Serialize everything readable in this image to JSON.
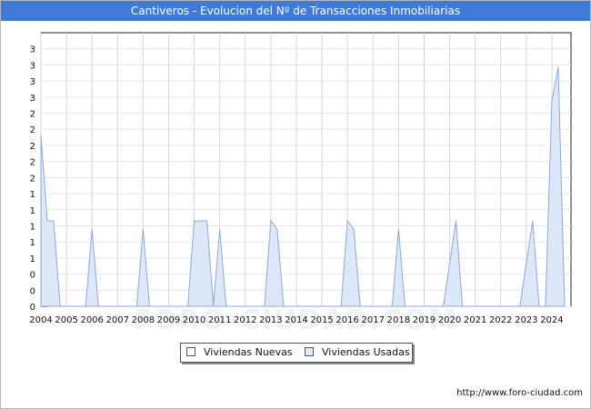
{
  "chart_data": {
    "type": "area",
    "title": "Cantiveros - Evolucion del Nº de Transacciones Inmobiliarias",
    "xlabel": "",
    "ylabel": "",
    "y_tick_labels": [
      "0",
      "0",
      "0",
      "1",
      "1",
      "1",
      "1",
      "1",
      "2",
      "2",
      "2",
      "2",
      "2",
      "3",
      "3",
      "3",
      "3"
    ],
    "ylim": [
      0,
      3.2
    ],
    "x_tick_labels": [
      "2004",
      "2005",
      "2006",
      "2007",
      "2008",
      "2009",
      "2010",
      "2011",
      "2012",
      "2013",
      "2014",
      "2015",
      "2016",
      "2017",
      "2018",
      "2019",
      "2020",
      "2021",
      "2022",
      "2023",
      "2024"
    ],
    "xlim": [
      2004,
      2024.75
    ],
    "grid": true,
    "legend_position": "bottom-center",
    "series": [
      {
        "name": "Viviendas Nuevas",
        "color": "#ffffff",
        "points": [
          [
            2004.0,
            0
          ],
          [
            2004.1,
            0
          ],
          [
            2004.25,
            0
          ]
        ]
      },
      {
        "name": "Viviendas Usadas",
        "color": "#dce8f8",
        "points": [
          [
            2004.0,
            2.0
          ],
          [
            2004.25,
            1.0
          ],
          [
            2004.5,
            1.0
          ],
          [
            2004.75,
            0
          ],
          [
            2005.75,
            0
          ],
          [
            2006.0,
            0.9
          ],
          [
            2006.25,
            0
          ],
          [
            2007.75,
            0
          ],
          [
            2008.0,
            0.9
          ],
          [
            2008.25,
            0
          ],
          [
            2009.75,
            0
          ],
          [
            2010.0,
            1.0
          ],
          [
            2010.5,
            1.0
          ],
          [
            2010.75,
            0
          ],
          [
            2011.0,
            0.9
          ],
          [
            2011.25,
            0
          ],
          [
            2012.75,
            0
          ],
          [
            2013.0,
            1.0
          ],
          [
            2013.25,
            0.9
          ],
          [
            2013.5,
            0
          ],
          [
            2015.75,
            0
          ],
          [
            2016.0,
            1.0
          ],
          [
            2016.25,
            0.9
          ],
          [
            2016.5,
            0
          ],
          [
            2017.75,
            0
          ],
          [
            2018.0,
            0.9
          ],
          [
            2018.25,
            0
          ],
          [
            2019.75,
            0
          ],
          [
            2020.25,
            1.0
          ],
          [
            2020.5,
            0
          ],
          [
            2022.75,
            0
          ],
          [
            2023.25,
            1.0
          ],
          [
            2023.5,
            0
          ],
          [
            2023.75,
            0
          ],
          [
            2024.0,
            2.4
          ],
          [
            2024.25,
            2.8
          ],
          [
            2024.5,
            0
          ]
        ]
      }
    ]
  },
  "source": "http://www.foro-ciudad.com",
  "watermark": "FORO-CIUDAD.COM"
}
